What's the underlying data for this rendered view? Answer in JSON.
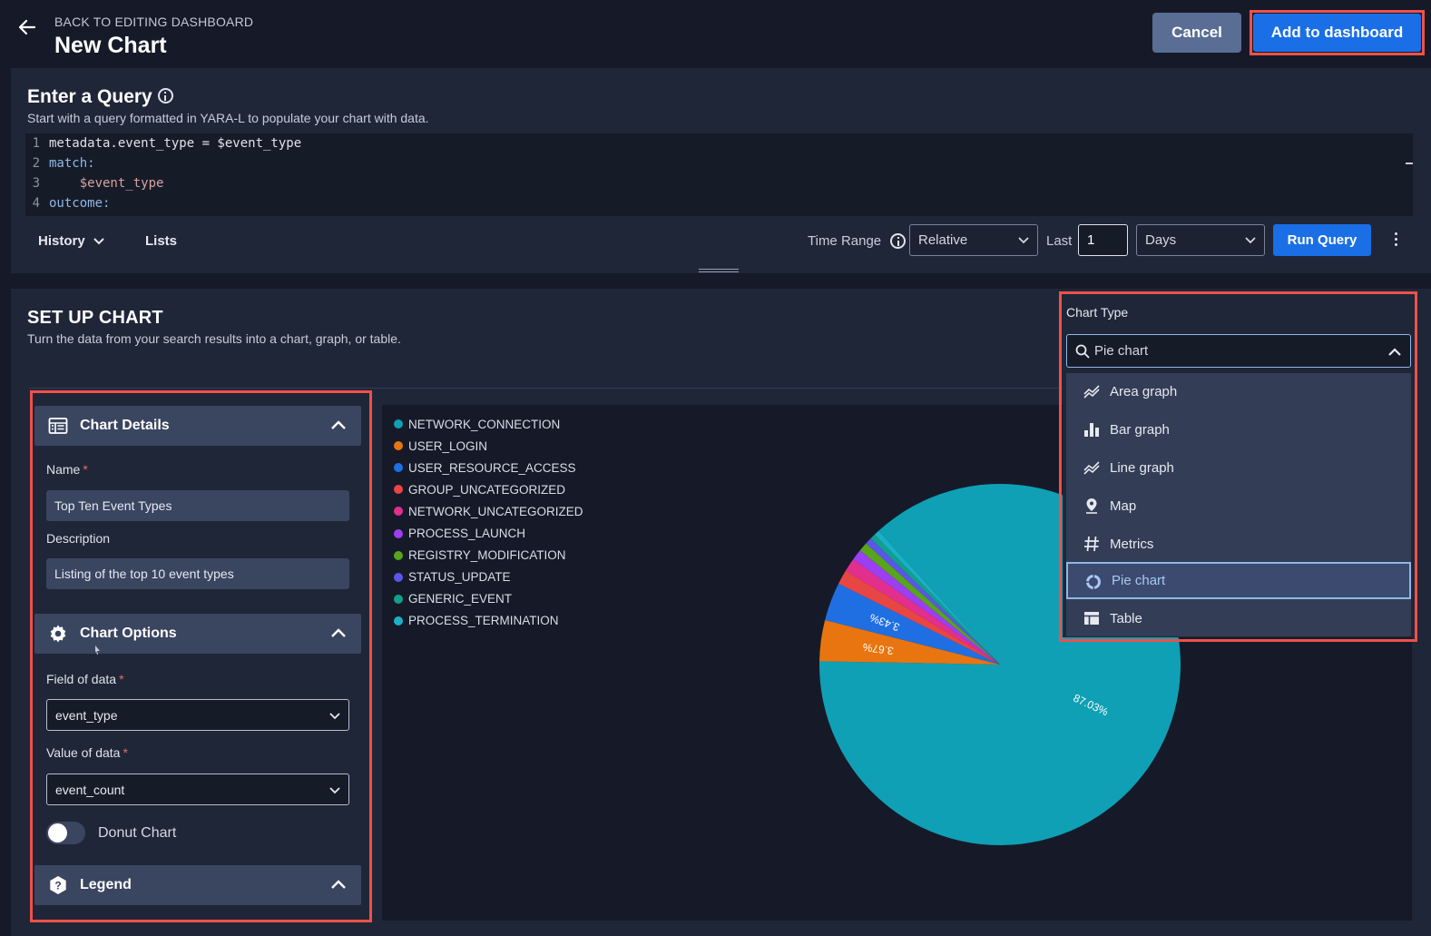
{
  "header": {
    "back_label": "BACK TO EDITING DASHBOARD",
    "title": "New Chart",
    "cancel_label": "Cancel",
    "add_label": "Add to dashboard"
  },
  "query": {
    "title": "Enter a Query",
    "subtitle": "Start with a query formatted in YARA-L to populate your chart with data.",
    "lines": [
      {
        "n": "1",
        "text": "metadata.event_type = $event_type"
      },
      {
        "n": "2",
        "text": "match:"
      },
      {
        "n": "3",
        "text": "    $event_type"
      },
      {
        "n": "4",
        "text": "outcome:"
      }
    ],
    "history_label": "History",
    "lists_label": "Lists",
    "time_range_label": "Time Range",
    "relative_value": "Relative",
    "last_label": "Last",
    "last_value": "1",
    "unit_value": "Days",
    "run_label": "Run Query"
  },
  "setup": {
    "title": "SET UP CHART",
    "subtitle": "Turn the data from your search results into a chart, graph, or table.",
    "details": {
      "header": "Chart Details",
      "name_label": "Name",
      "name_value": "Top Ten Event Types",
      "description_label": "Description",
      "description_value": "Listing of the top 10 event types"
    },
    "options": {
      "header": "Chart Options",
      "field_label": "Field of data",
      "field_value": "event_type",
      "value_label": "Value of data",
      "value_value": "event_count",
      "donut_label": "Donut Chart",
      "donut_on": false
    },
    "legend_header": "Legend",
    "required_mark": "*"
  },
  "chart_type": {
    "label": "Chart Type",
    "search_value": "Pie chart",
    "options": [
      {
        "label": "Area graph",
        "icon": "area-graph-icon"
      },
      {
        "label": "Bar graph",
        "icon": "bar-graph-icon"
      },
      {
        "label": "Line graph",
        "icon": "line-graph-icon"
      },
      {
        "label": "Map",
        "icon": "map-pin-icon"
      },
      {
        "label": "Metrics",
        "icon": "hash-icon"
      },
      {
        "label": "Pie chart",
        "icon": "pie-chart-icon"
      },
      {
        "label": "Table",
        "icon": "table-icon"
      }
    ],
    "selected": "Pie chart"
  },
  "chart_data": {
    "type": "pie",
    "title": "",
    "series": [
      {
        "name": "NETWORK_CONNECTION",
        "value": 87.03,
        "color": "#0fa0b5",
        "label": "87.03%"
      },
      {
        "name": "USER_LOGIN",
        "value": 3.67,
        "color": "#e8750f",
        "label": "3.67%"
      },
      {
        "name": "USER_RESOURCE_ACCESS",
        "value": 3.43,
        "color": "#1f6fe3",
        "label": "3.43%"
      },
      {
        "name": "GROUP_UNCATEGORIZED",
        "value": 1.3,
        "color": "#e84545",
        "label": ""
      },
      {
        "name": "NETWORK_UNCATEGORIZED",
        "value": 1.2,
        "color": "#e22f8e",
        "label": ""
      },
      {
        "name": "PROCESS_LAUNCH",
        "value": 1.0,
        "color": "#9b3ff0",
        "label": ""
      },
      {
        "name": "REGISTRY_MODIFICATION",
        "value": 0.8,
        "color": "#58a51c",
        "label": ""
      },
      {
        "name": "STATUS_UPDATE",
        "value": 0.6,
        "color": "#5b56ea",
        "label": ""
      },
      {
        "name": "GENERIC_EVENT",
        "value": 0.5,
        "color": "#12a08c",
        "label": ""
      },
      {
        "name": "PROCESS_TERMINATION",
        "value": 0.47,
        "color": "#1ab0c8",
        "label": ""
      }
    ],
    "legend_position": "top-left"
  }
}
